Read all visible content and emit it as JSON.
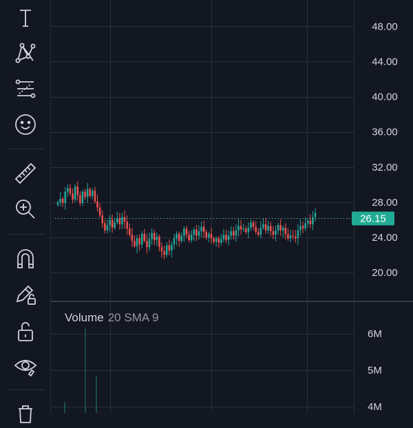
{
  "toolbar": {
    "tools": [
      {
        "name": "text-tool",
        "icon": "text-icon"
      },
      {
        "name": "pattern-tool",
        "icon": "pattern-icon"
      },
      {
        "name": "prediction-tool",
        "icon": "prediction-icon"
      },
      {
        "name": "emoji-tool",
        "icon": "smiley-icon"
      },
      {
        "name": "measure-tool",
        "icon": "ruler-icon"
      },
      {
        "name": "zoom-tool",
        "icon": "zoom-in-icon"
      },
      {
        "name": "magnet-tool",
        "icon": "magnet-icon"
      },
      {
        "name": "lock-drawings-tool",
        "icon": "pencil-lock-icon"
      },
      {
        "name": "lock-all-tool",
        "icon": "unlock-icon"
      },
      {
        "name": "hide-tool",
        "icon": "eye-icon"
      },
      {
        "name": "remove-tool",
        "icon": "trash-icon"
      }
    ]
  },
  "price_axis": {
    "labels": [
      "48.00",
      "44.00",
      "40.00",
      "36.00",
      "32.00",
      "28.00",
      "24.00",
      "20.00"
    ],
    "current_price": "26.15"
  },
  "volume_pane": {
    "title": "Volume",
    "params": "20 SMA 9",
    "axis_labels": [
      "6M",
      "5M",
      "4M"
    ]
  },
  "colors": {
    "background": "#131722",
    "up": "#26a69a",
    "down": "#ef5350",
    "grid": "#2a2e39",
    "current_price_badge": "#22ab94"
  },
  "chart_data": {
    "type": "candlestick",
    "ylim": [
      16.8,
      51
    ],
    "y_ticks": [
      48,
      44,
      40,
      36,
      32,
      28,
      24,
      20
    ],
    "current_price": 26.15,
    "x_gridlines": 4,
    "closes": [
      28.0,
      28.4,
      27.9,
      29.2,
      29.6,
      29.0,
      28.3,
      29.8,
      28.8,
      27.9,
      29.2,
      28.6,
      29.5,
      28.7,
      29.3,
      28.1,
      27.4,
      26.5,
      25.6,
      24.8,
      25.4,
      26.0,
      25.1,
      25.7,
      26.2,
      25.5,
      26.3,
      25.8,
      25.0,
      24.3,
      23.6,
      23.0,
      23.9,
      23.2,
      24.4,
      23.6,
      22.9,
      23.8,
      24.5,
      23.7,
      24.1,
      22.9,
      22.4,
      22.0,
      23.1,
      22.5,
      23.2,
      23.9,
      24.4,
      23.6,
      24.2,
      25.0,
      24.3,
      23.7,
      24.3,
      24.9,
      24.2,
      24.7,
      25.2,
      24.6,
      24.0,
      24.4,
      23.9,
      23.5,
      23.9,
      23.4,
      23.8,
      24.3,
      23.7,
      24.2,
      24.7,
      24.2,
      24.8,
      25.3,
      24.9,
      25.0,
      24.6,
      25.1,
      25.7,
      25.2,
      24.6,
      24.3,
      25.1,
      25.5,
      24.8,
      25.3,
      24.7,
      24.3,
      24.8,
      25.4,
      24.8,
      25.1,
      24.4,
      23.9,
      24.2,
      24.1,
      23.9,
      24.8,
      25.3,
      25.0,
      25.6,
      25.9,
      25.5,
      26.3,
      26.8
    ]
  }
}
